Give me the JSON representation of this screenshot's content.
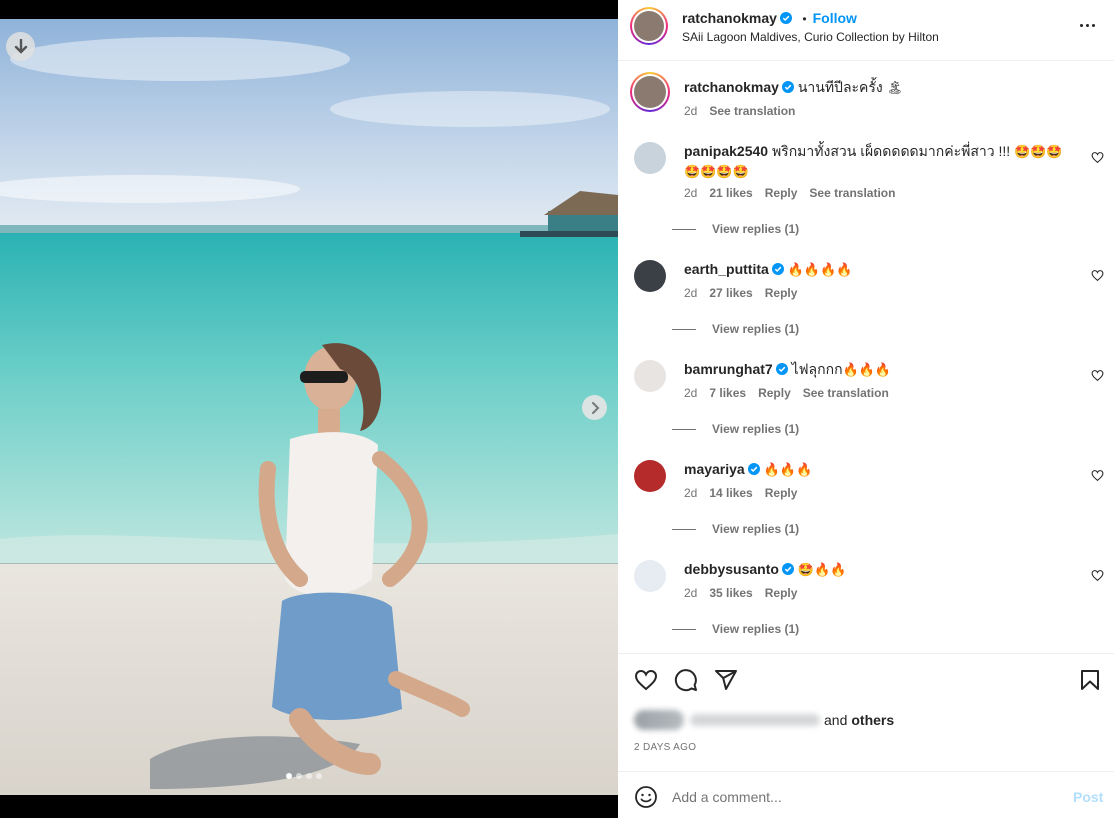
{
  "post": {
    "username": "ratchanokmay",
    "follow_label": "Follow",
    "location": "SAii Lagoon Maldives, Curio Collection by Hilton",
    "caption_text": "นานทีปีละครั้ง",
    "caption_emoji": "🏝",
    "caption_time": "2d",
    "see_translation": "See translation"
  },
  "comments": [
    {
      "username": "panipak2540",
      "verified": false,
      "text": "พริกมาทั้งสวน เผ็ดดดดดมากค่ะพี่สาว !!!",
      "emoji": "🤩🤩🤩",
      "emoji2": "🤩🤩🤩🤩",
      "time": "2d",
      "likes": "21 likes",
      "reply": "Reply",
      "translate": "See translation",
      "view_replies": "View replies (1)",
      "avatar_color": "#c9d3dc"
    },
    {
      "username": "earth_puttita",
      "verified": true,
      "text": "",
      "emoji": "🔥🔥🔥🔥",
      "time": "2d",
      "likes": "27 likes",
      "reply": "Reply",
      "translate": "",
      "view_replies": "View replies (1)",
      "avatar_color": "#3b3f46"
    },
    {
      "username": "bamrunghat7",
      "verified": true,
      "text": "ไฟลุกกก",
      "emoji": "🔥🔥🔥",
      "time": "2d",
      "likes": "7 likes",
      "reply": "Reply",
      "translate": "See translation",
      "view_replies": "View replies (1)",
      "avatar_color": "#e8e4e2"
    },
    {
      "username": "mayariya",
      "verified": true,
      "text": "",
      "emoji": "🔥🔥🔥",
      "time": "2d",
      "likes": "14 likes",
      "reply": "Reply",
      "translate": "",
      "view_replies": "View replies (1)",
      "avatar_color": "#b52a2a"
    },
    {
      "username": "debbysusanto",
      "verified": true,
      "text": "",
      "emoji": "🤩🔥🔥",
      "time": "2d",
      "likes": "35 likes",
      "reply": "Reply",
      "translate": "",
      "view_replies": "View replies (1)",
      "avatar_color": "#e6ecf1"
    }
  ],
  "likes_line": {
    "and_label": "and",
    "others_label": "others"
  },
  "timestamp": "2 DAYS AGO",
  "add_comment": {
    "placeholder": "Add a comment...",
    "post_label": "Post"
  },
  "carousel": {
    "slides": 4,
    "active": 1
  },
  "colors": {
    "accent": "#0095f6",
    "post_disabled": "#b2dffc",
    "muted": "#737373"
  }
}
